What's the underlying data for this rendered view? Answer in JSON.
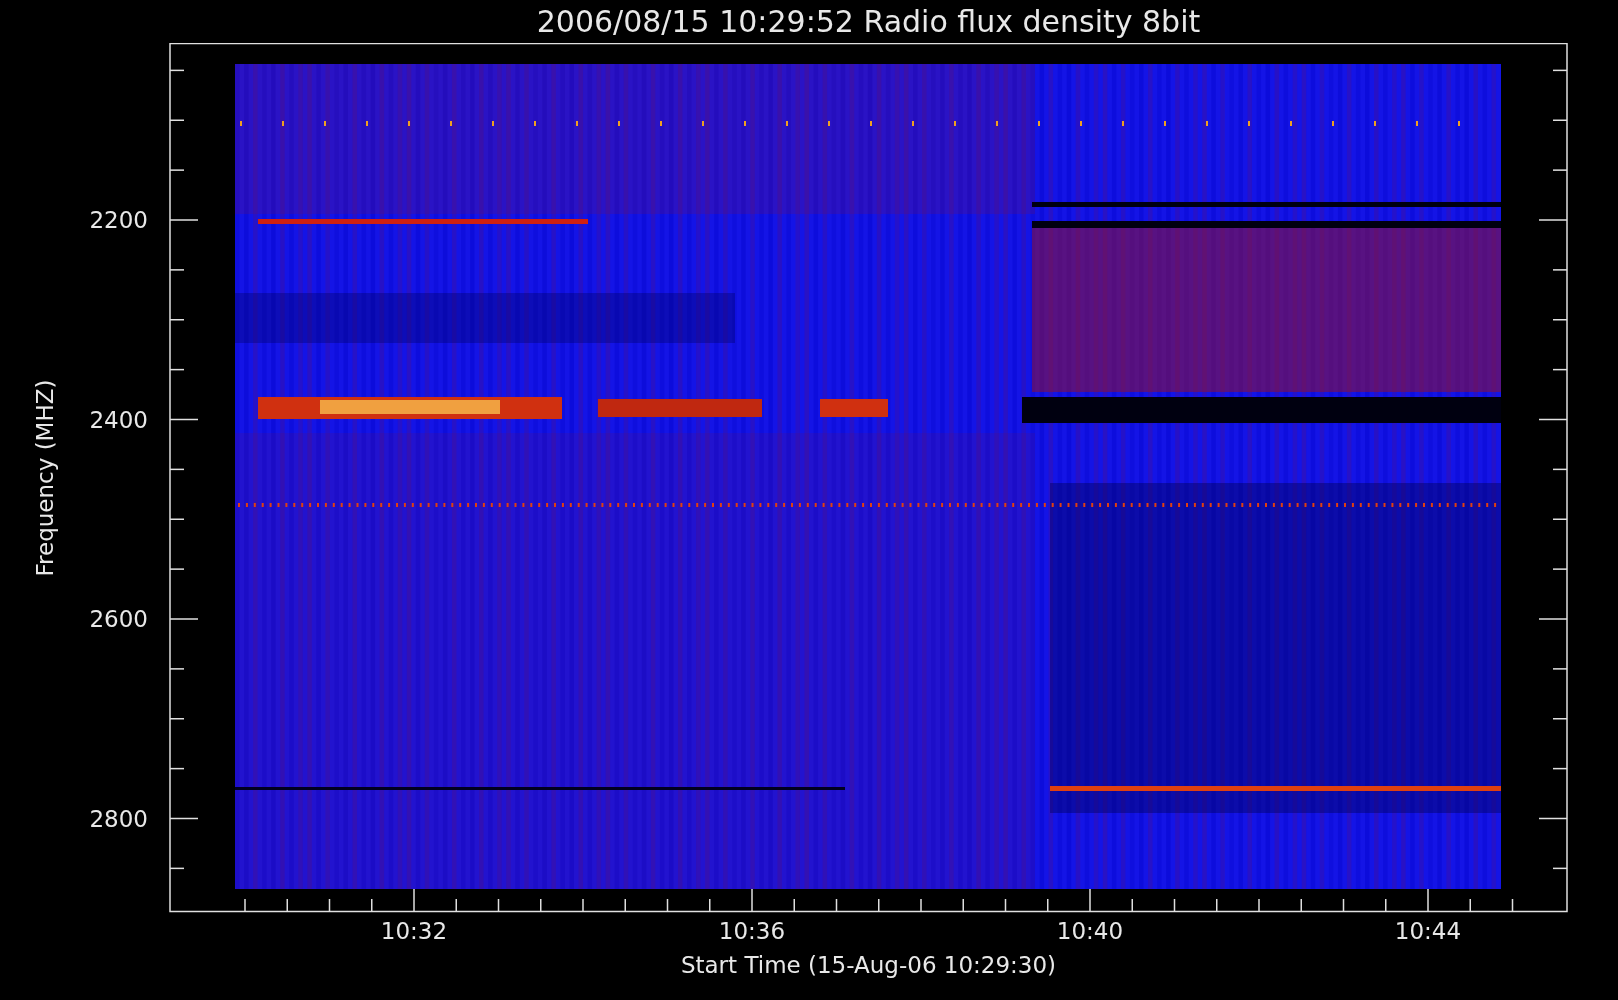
{
  "title": "2006/08/15 10:29:52 Radio flux density 8bit",
  "y_axis": {
    "label": "Frequency (MHZ)",
    "tick_labels": [
      "2200",
      "2400",
      "2600",
      "2800"
    ]
  },
  "x_axis": {
    "label": "Start Time (15-Aug-06 10:29:30)",
    "tick_labels": [
      "10:32",
      "10:36",
      "10:40",
      "10:44"
    ]
  }
}
